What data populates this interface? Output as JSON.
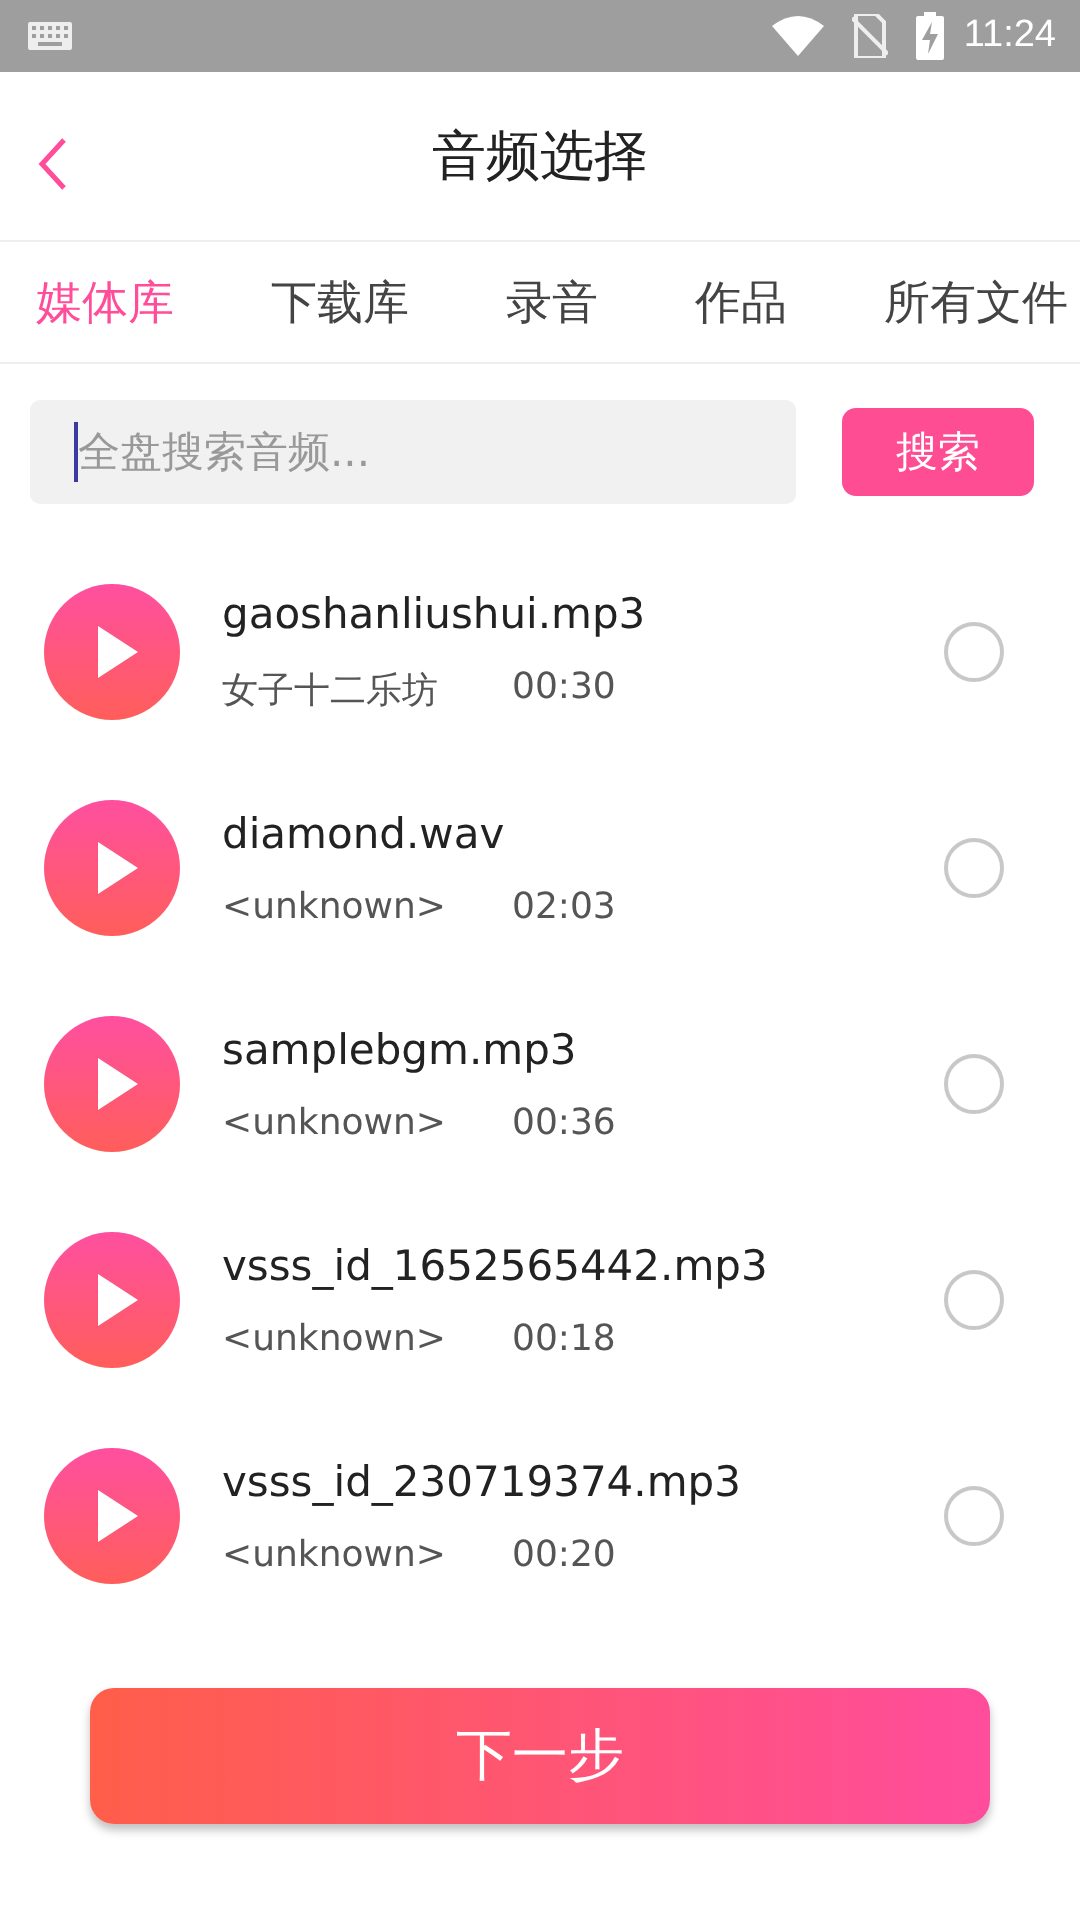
{
  "status_bar": {
    "time": "11:24"
  },
  "header": {
    "title": "音频选择"
  },
  "tabs": [
    {
      "label": "媒体库",
      "selected": true
    },
    {
      "label": "下载库",
      "selected": false
    },
    {
      "label": "录音",
      "selected": false
    },
    {
      "label": "作品",
      "selected": false
    },
    {
      "label": "所有文件",
      "selected": false
    }
  ],
  "search": {
    "placeholder": "全盘搜索音频...",
    "button": "搜索"
  },
  "files": [
    {
      "name": "gaoshanliushui.mp3",
      "artist": "女子十二乐坊",
      "duration": "00:30",
      "selected": false
    },
    {
      "name": "diamond.wav",
      "artist": "<unknown>",
      "duration": "02:03",
      "selected": false
    },
    {
      "name": "samplebgm.mp3",
      "artist": "<unknown>",
      "duration": "00:36",
      "selected": false
    },
    {
      "name": "vsss_id_1652565442.mp3",
      "artist": "<unknown>",
      "duration": "00:18",
      "selected": false
    },
    {
      "name": "vsss_id_230719374.mp3",
      "artist": "<unknown>",
      "duration": "00:20",
      "selected": false
    }
  ],
  "next_button": "下一步"
}
